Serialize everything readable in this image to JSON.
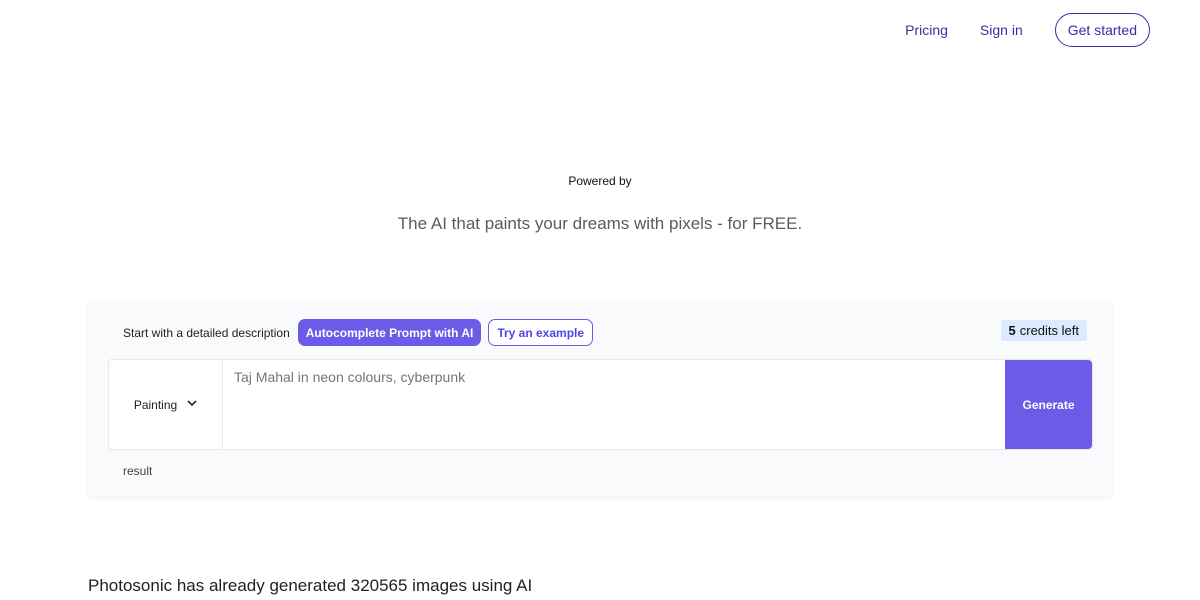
{
  "nav": {
    "pricing": "Pricing",
    "sign_in": "Sign in",
    "get_started": "Get started"
  },
  "hero": {
    "powered_by": "Powered by",
    "tagline": "The AI that paints your dreams with pixels - for FREE."
  },
  "generator": {
    "start_label": "Start with a detailed description",
    "autocomplete_label": "Autocomplete Prompt with AI",
    "try_example_label": "Try an example",
    "credits_count": "5",
    "credits_text": "credits left",
    "style_selected": "Painting",
    "prompt_placeholder": "Taj Mahal in neon colours, cyberpunk",
    "generate_label": "Generate",
    "result_label": "result"
  },
  "stats": {
    "text": "Photosonic has already generated 320565 images using AI"
  },
  "colors": {
    "accent": "#6d5ae8",
    "nav_text": "#3730a3",
    "credits_bg": "#dbeafe"
  }
}
